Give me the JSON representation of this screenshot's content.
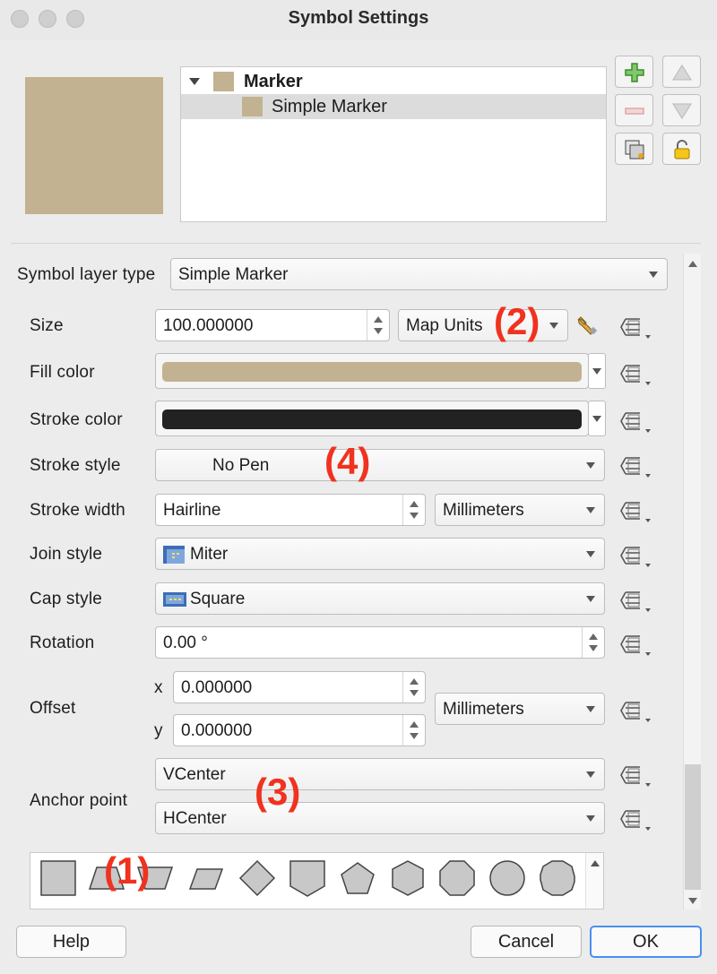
{
  "window": {
    "title": "Symbol Settings"
  },
  "colors": {
    "fill": "#c2b291",
    "stroke": "#222222",
    "accent": "#4a8ff0",
    "annotation": "#f0321e"
  },
  "tree": {
    "items": [
      {
        "label": "Marker",
        "bold": true,
        "expanded": true
      },
      {
        "label": "Simple Marker",
        "bold": false,
        "selected": true
      }
    ]
  },
  "toolbar": {
    "icons": [
      "add-layer-icon",
      "move-up-icon",
      "remove-layer-icon",
      "move-down-icon",
      "duplicate-layer-icon",
      "lock-icon"
    ]
  },
  "symbol_layer_type": {
    "label": "Symbol layer type",
    "value": "Simple Marker"
  },
  "size": {
    "label": "Size",
    "value": "100.000000",
    "unit": "Map Units"
  },
  "fill_color": {
    "label": "Fill color"
  },
  "stroke_color": {
    "label": "Stroke color"
  },
  "stroke_style": {
    "label": "Stroke style",
    "value": "No Pen"
  },
  "stroke_width": {
    "label": "Stroke width",
    "value": "Hairline",
    "unit": "Millimeters"
  },
  "join_style": {
    "label": "Join style",
    "value": "Miter"
  },
  "cap_style": {
    "label": "Cap style",
    "value": "Square"
  },
  "rotation": {
    "label": "Rotation",
    "value": "0.00 °"
  },
  "offset": {
    "label": "Offset",
    "x_label": "x",
    "x": "0.000000",
    "y_label": "y",
    "y": "0.000000",
    "unit": "Millimeters"
  },
  "anchor": {
    "label": "Anchor point",
    "vertical": "VCenter",
    "horizontal": "HCenter"
  },
  "annotations": [
    "(1)",
    "(2)",
    "(3)",
    "(4)"
  ],
  "shapes": [
    "square",
    "trapezoid",
    "trapezoid-inverted",
    "parallelogram",
    "diamond",
    "shield",
    "pentagon",
    "hexagon",
    "octagon",
    "circle",
    "decagon"
  ],
  "footer": {
    "help": "Help",
    "cancel": "Cancel",
    "ok": "OK"
  }
}
